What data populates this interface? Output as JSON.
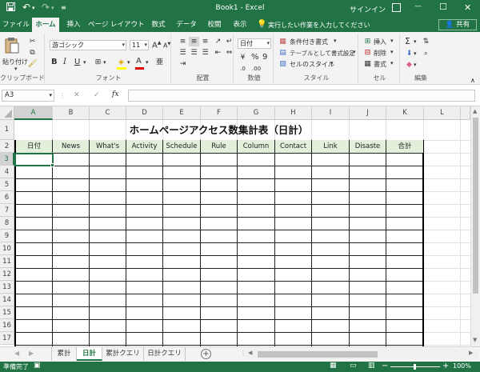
{
  "titlebar": {
    "qat": {
      "save_icon": "save-icon",
      "undo_icon": "undo-icon",
      "redo_icon": "redo-icon",
      "customize_icon": "customize-qat-icon"
    },
    "title": "Book1 - Excel",
    "signin": "サインイン",
    "ribbon_display_icon": "ribbon-display-options-icon",
    "minimize": "—",
    "maximize": "☐",
    "close": "✕"
  },
  "tabs": [
    {
      "label": "ファイル"
    },
    {
      "label": "ホーム"
    },
    {
      "label": "挿入"
    },
    {
      "label": "ページ レイアウト"
    },
    {
      "label": "数式"
    },
    {
      "label": "データ"
    },
    {
      "label": "校閲"
    },
    {
      "label": "表示"
    }
  ],
  "tellme": "実行したい作業を入力してください",
  "share": "共有",
  "ribbon": {
    "clipboard": {
      "paste": "貼り付け",
      "label": "クリップボード"
    },
    "font": {
      "name": "游ゴシック",
      "size": "11",
      "grow": "A",
      "shrink": "A",
      "bold": "B",
      "italic": "I",
      "underline": "U",
      "font_color": "A",
      "label": "フォント"
    },
    "alignment": {
      "label": "配置"
    },
    "number": {
      "format": "日付",
      "percent": "%",
      "comma": "9",
      "label": "数値"
    },
    "styles": {
      "conditional": "条件付き書式",
      "table": "テーブルとして書式設定",
      "cell": "セルのスタイル",
      "label": "スタイル"
    },
    "cells": {
      "insert": "挿入",
      "delete": "削除",
      "format": "書式",
      "label": "セル"
    },
    "editing": {
      "sum": "Σ",
      "label": "編集"
    }
  },
  "formulabar": {
    "namebox": "A3",
    "cancel": "✕",
    "enter": "✓",
    "fx": "fx",
    "content": ""
  },
  "columns": [
    "A",
    "B",
    "C",
    "D",
    "E",
    "F",
    "G",
    "H",
    "I",
    "J",
    "K",
    "L"
  ],
  "rows": [
    "1",
    "2",
    "3",
    "4",
    "5",
    "6",
    "7",
    "8",
    "9",
    "10",
    "11",
    "12",
    "13",
    "14",
    "15",
    "16",
    "17"
  ],
  "sheet": {
    "title": "ホームページアクセス数集計表（日計）",
    "headers": [
      "日付",
      "News",
      "What's",
      "Activity",
      "Schedule",
      "Rule",
      "Column",
      "Contact",
      "Link",
      "Disaste",
      "合計"
    ]
  },
  "sheet_tabs": [
    {
      "label": "累計",
      "active": false
    },
    {
      "label": "日計",
      "active": true
    },
    {
      "label": "累計クエリ",
      "active": false
    },
    {
      "label": "日計クエリ",
      "active": false
    }
  ],
  "status": {
    "ready": "準備完了",
    "zoom": "100%",
    "zoom_minus": "−",
    "zoom_plus": "+"
  },
  "colors": {
    "excel_green": "#217346",
    "header_fill": "#e2efda"
  }
}
